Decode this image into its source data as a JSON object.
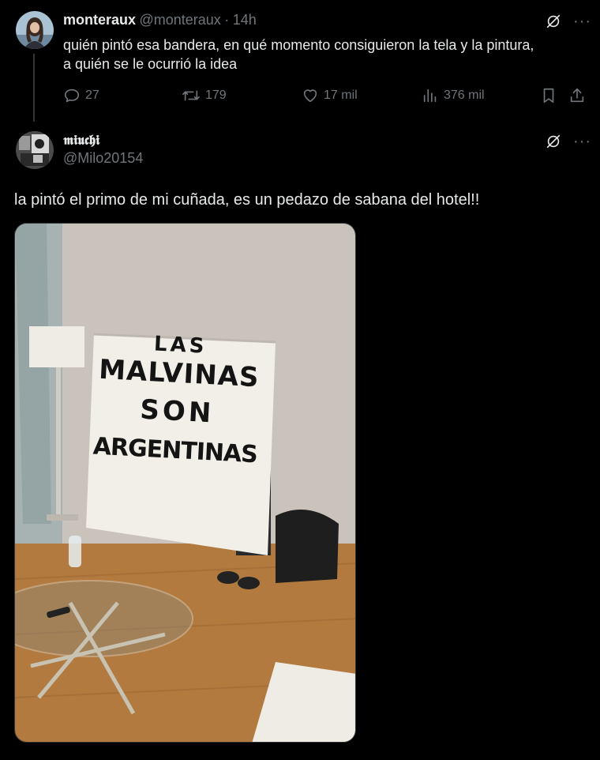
{
  "tweet1": {
    "display_name": "monteraux",
    "handle": "@monteraux",
    "separator": "·",
    "time": "14h",
    "text_line1": "quién pintó esa bandera, en qué momento consiguieron la tela y la pintura,",
    "text_line2": "a quién se le ocurrió la idea",
    "replies": "27",
    "retweets": "179",
    "likes": "17 mil",
    "views": "376 mil"
  },
  "tweet2": {
    "display_name": "𝖒𝖎𝖚𝖈𝖍𝖎",
    "handle": "@Milo20154",
    "text": "la pintó el primo de mi cuñada, es un pedazo de sabana del hotel!!",
    "photo": {
      "banner_lines": [
        "LAS",
        "MALVINAS",
        "SON",
        "ARGENTINAS"
      ]
    }
  },
  "colors": {
    "background": "#000000",
    "text": "#e7e9ea",
    "secondary": "#71767b",
    "divider": "#333639"
  },
  "icons": [
    "reply-icon",
    "retweet-icon",
    "like-icon",
    "views-icon",
    "bookmark-icon",
    "share-icon",
    "grok-icon",
    "more-icon"
  ]
}
